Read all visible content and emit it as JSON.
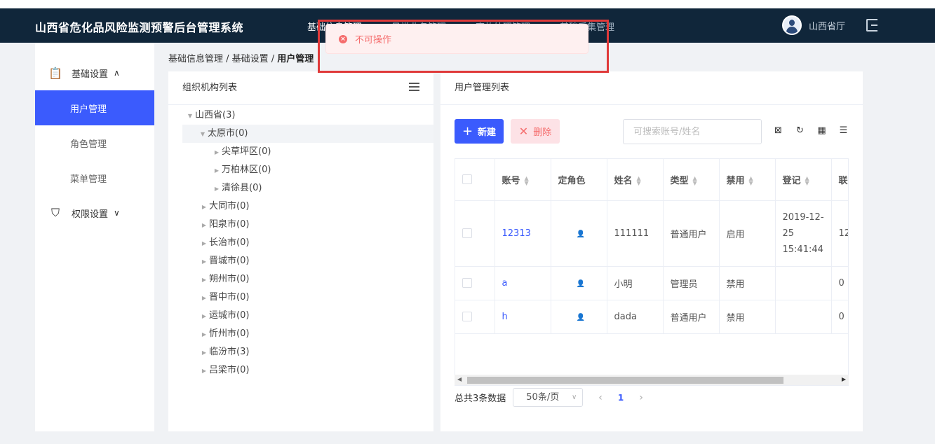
{
  "header": {
    "title": "山西省危化品风险监测预警后台管理系统",
    "nav": [
      "基础信息管理",
      "日常业务管理",
      "事故处理管理",
      "基础采集管理"
    ],
    "user": "山西省厅"
  },
  "toast": {
    "message": "不可操作"
  },
  "sidebar": {
    "groups": [
      {
        "label": "基础设置",
        "icon": "clipboard-icon",
        "expanded": true,
        "items": [
          "用户管理",
          "角色管理",
          "菜单管理"
        ]
      },
      {
        "label": "权限设置",
        "icon": "shield-icon",
        "expanded": false
      }
    ]
  },
  "breadcrumb": {
    "path": "基础信息管理 / 基础设置 / ",
    "current": "用户管理"
  },
  "org_panel": {
    "title": "组织机构列表",
    "tree": [
      {
        "label": "山西省(3)"
      },
      {
        "label": "太原市(0)"
      },
      {
        "label": "尖草坪区(0)"
      },
      {
        "label": "万柏林区(0)"
      },
      {
        "label": "清徐县(0)"
      },
      {
        "label": "大同市(0)"
      },
      {
        "label": "阳泉市(0)"
      },
      {
        "label": "长治市(0)"
      },
      {
        "label": "晋城市(0)"
      },
      {
        "label": "朔州市(0)"
      },
      {
        "label": "晋中市(0)"
      },
      {
        "label": "运城市(0)"
      },
      {
        "label": "忻州市(0)"
      },
      {
        "label": "临汾市(3)"
      },
      {
        "label": "吕梁市(0)"
      }
    ]
  },
  "user_panel": {
    "title": "用户管理列表",
    "new_label": "新建",
    "delete_label": "删除",
    "search_placeholder": "可搜索账号/姓名",
    "columns": [
      "账号",
      "定角色",
      "姓名",
      "类型",
      "禁用",
      "登记",
      "联"
    ],
    "rows": [
      {
        "account": "12313",
        "name": "111111",
        "type": "普通用户",
        "status": "启用",
        "registered": "2019-12-25 15:41:44",
        "contact": "12"
      },
      {
        "account": "a",
        "name": "小明",
        "type": "管理员",
        "status": "禁用",
        "registered": "",
        "contact": "0"
      },
      {
        "account": "h",
        "name": "dada",
        "type": "普通用户",
        "status": "禁用",
        "registered": "",
        "contact": "0"
      }
    ],
    "total_text": "总共3条数据",
    "page_size": "50条/页",
    "page": "1"
  }
}
